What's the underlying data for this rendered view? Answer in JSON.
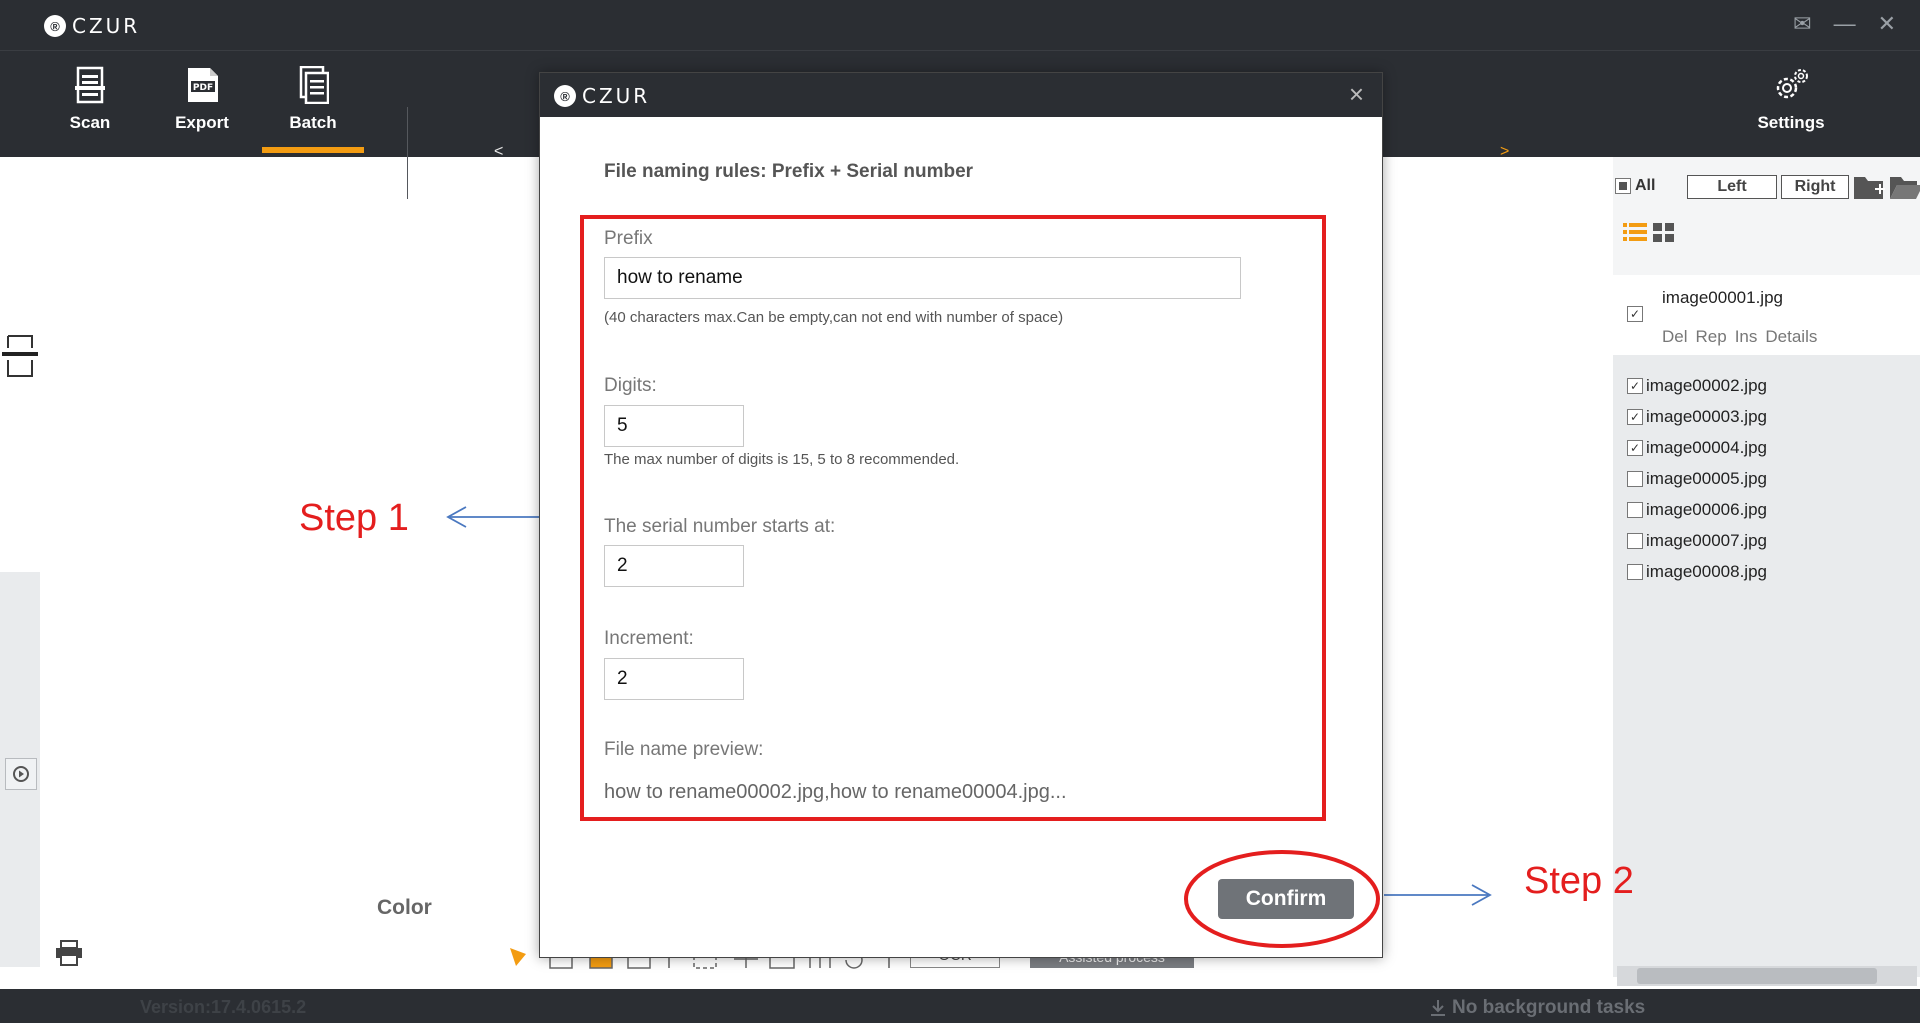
{
  "app": {
    "brand": "CZUR",
    "brand_glyph": "®",
    "window_controls": {
      "mail": "✉",
      "minimize": "—",
      "close": "✕"
    }
  },
  "toolbar": {
    "scan_label": "Scan",
    "export_label": "Export",
    "batch_label": "Batch",
    "settings_label": "Settings",
    "prev_arrow": "<",
    "next_arrow": ">"
  },
  "canvas": {
    "color_label": "Color",
    "ocr_label": "OCR",
    "assist_label": "Assisted process"
  },
  "annotations": {
    "step1": "Step 1",
    "step2": "Step 2"
  },
  "right_panel": {
    "all_label": "All",
    "left_btn": "Left",
    "right_btn": "Right",
    "first_file": "image00001.jpg",
    "actions": [
      "Del",
      "Rep",
      "Ins",
      "Details"
    ],
    "files": [
      {
        "name": "image00002.jpg",
        "checked": "✓"
      },
      {
        "name": "image00003.jpg",
        "checked": "✓"
      },
      {
        "name": "image00004.jpg",
        "checked": "✓"
      },
      {
        "name": "image00005.jpg",
        "checked": ""
      },
      {
        "name": "image00006.jpg",
        "checked": ""
      },
      {
        "name": "image00007.jpg",
        "checked": ""
      },
      {
        "name": "image00008.jpg",
        "checked": ""
      }
    ],
    "first_checked": "✓"
  },
  "status": {
    "version": "Version:17.4.0615.2",
    "background_tasks": "No background tasks"
  },
  "dialog": {
    "title": "CZUR",
    "close": "×",
    "rules": "File naming rules: Prefix + Serial number",
    "prefix_label": "Prefix",
    "prefix_value": "how to rename",
    "prefix_hint": "(40 characters max.Can be empty,can not end with number of space)",
    "digits_label": "Digits:",
    "digits_value": "5",
    "digits_hint": "The max number of digits is 15, 5 to 8 recommended.",
    "start_label": "The serial number starts at:",
    "start_value": "2",
    "increment_label": "Increment:",
    "increment_value": "2",
    "preview_label": "File name preview:",
    "preview_value": "how to rename00002.jpg,how to rename00004.jpg...",
    "confirm_label": "Confirm"
  },
  "colors": {
    "chrome": "#2b2e33",
    "accent": "#f39c12",
    "annotation_red": "#e41e1e",
    "annotation_blue": "#4a78c0"
  }
}
